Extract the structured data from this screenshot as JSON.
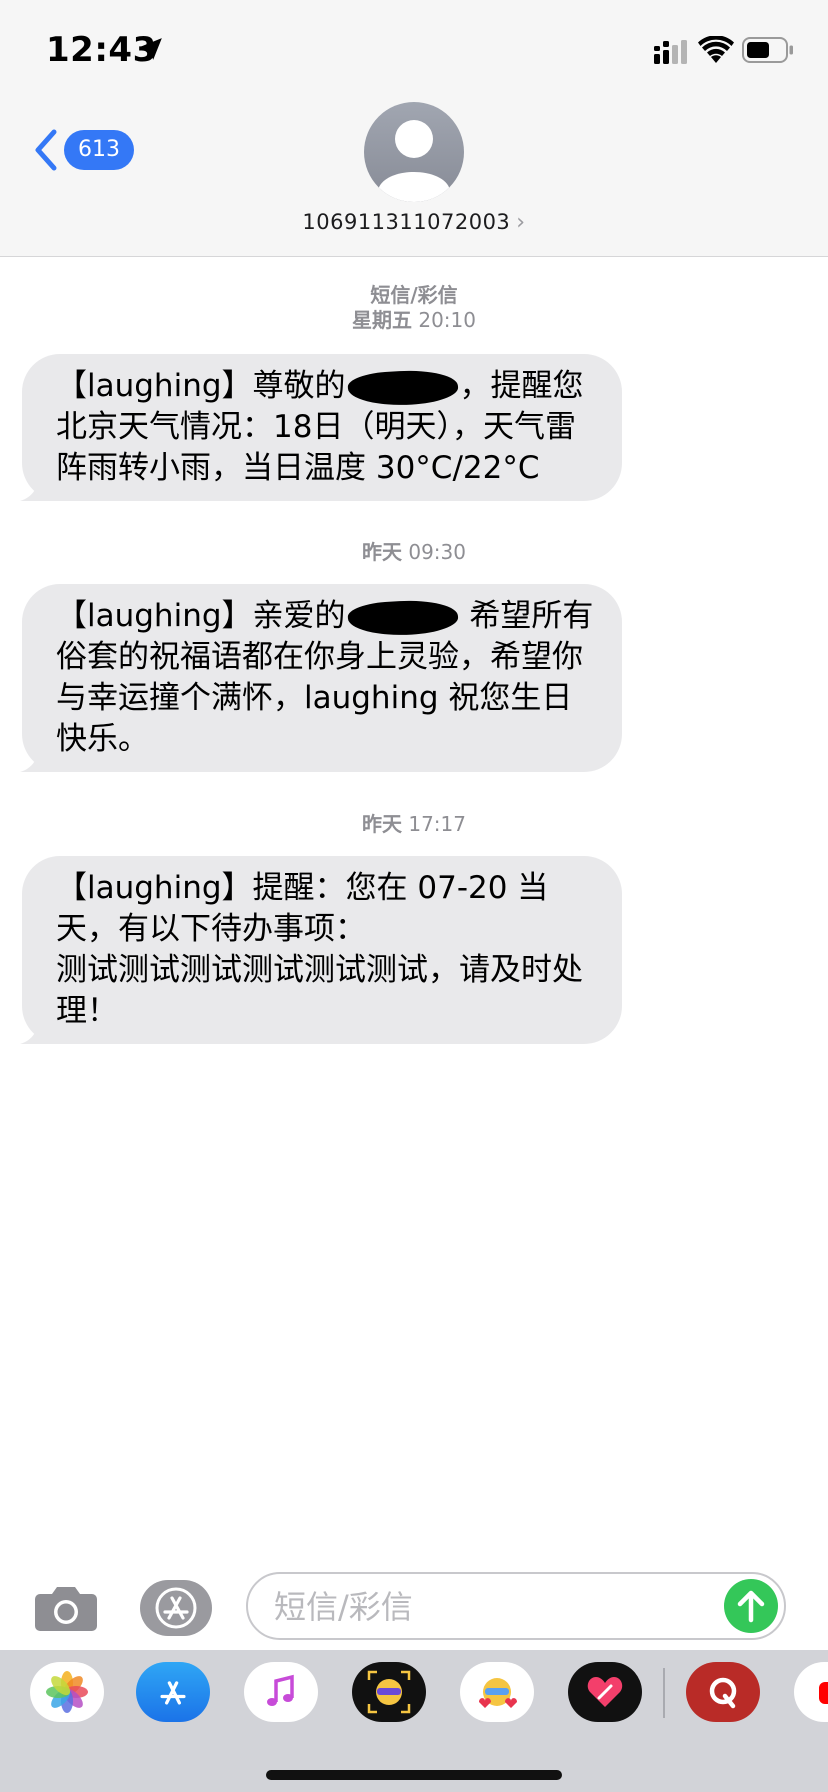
{
  "status_bar": {
    "time": "12:43",
    "icons": [
      "location-arrow-icon",
      "signal-icon",
      "wifi-icon",
      "battery-icon"
    ]
  },
  "nav": {
    "back_count": "613",
    "contact_number": "106911311072003",
    "contact_chevron": "›"
  },
  "conversation": [
    {
      "type_label": "短信/彩信",
      "time_day": "星期五",
      "time_clock": "20:10",
      "text_before": "【laughing】尊敬的",
      "text_after": "，提醒您北京天气情况：18日（明天），天气雷阵雨转小雨，当日温度 30°C/22°C"
    },
    {
      "time_day": "昨天",
      "time_clock": "09:30",
      "text_before": "【laughing】亲爱的",
      "text_after": " 希望所有俗套的祝福语都在你身上灵验，希望你与幸运撞个满怀，laughing 祝您生日快乐。"
    },
    {
      "time_day": "昨天",
      "time_clock": "17:17",
      "text": "【laughing】提醒：您在 07-20 当天，有以下待办事项：\n测试测试测试测试测试测试，请及时处理！"
    }
  ],
  "input": {
    "placeholder": "短信/彩信"
  },
  "drawer_apps": [
    "photos-icon",
    "app-store-icon",
    "music-icon",
    "memoji-icon",
    "memoji-hearts-icon",
    "heart-digital-touch-icon",
    "quora-icon",
    "youtube-icon"
  ],
  "colors": {
    "accent": "#3478f6",
    "bubble_received": "#e9e9eb",
    "send_button": "#34c759",
    "header_bg": "#f6f6f6",
    "drawer_bg": "#d2d3d8"
  }
}
